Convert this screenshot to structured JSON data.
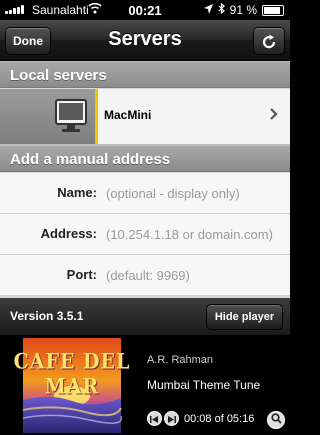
{
  "status_bar": {
    "carrier": "Saunalahti",
    "time": "00:21",
    "battery": "91 %",
    "battery_level": 0.91
  },
  "nav": {
    "done_label": "Done",
    "title": "Servers",
    "refresh_icon": "refresh-icon"
  },
  "local_servers": {
    "header": "Local servers",
    "items": [
      {
        "label": "MacMini",
        "icon": "monitor-icon"
      }
    ]
  },
  "manual": {
    "header": "Add a manual address",
    "fields": [
      {
        "label": "Name:",
        "placeholder": "(optional - display only)",
        "value": ""
      },
      {
        "label": "Address:",
        "placeholder": "(10.254.1.18 or domain.com)",
        "value": ""
      },
      {
        "label": "Port:",
        "placeholder": "(default: 9969)",
        "value": ""
      }
    ]
  },
  "player": {
    "version": "Version 3.5.1",
    "hide_label": "Hide player",
    "album_title": "CAFE DEL MAR",
    "artist": "A.R. Rahman",
    "track": "Mumbai Theme Tune",
    "time": "00:08 of 05:16"
  },
  "colors": {
    "selection_accent": "#f3c300",
    "section_header": "#9a9a9a"
  }
}
